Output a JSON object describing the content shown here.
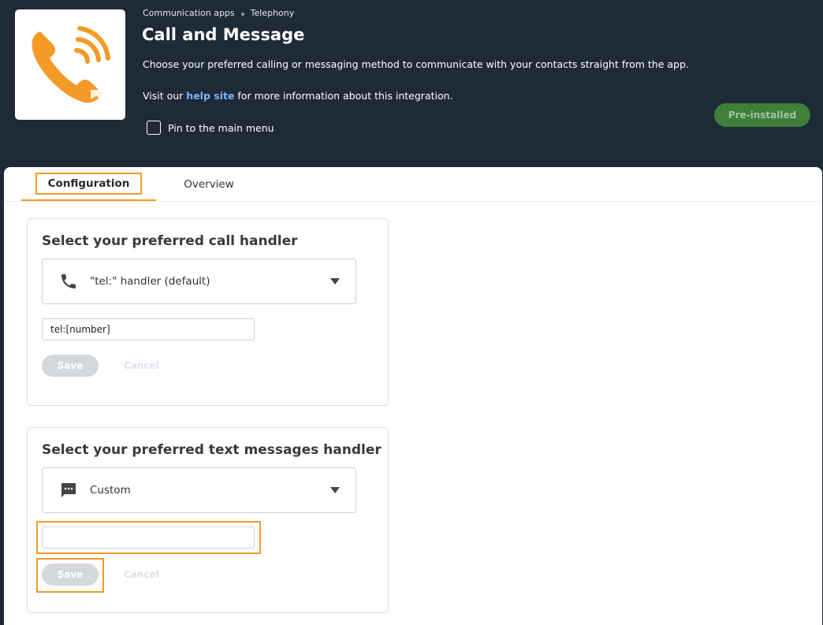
{
  "breadcrumb": {
    "parent": "Communication apps",
    "current": "Telephony"
  },
  "header": {
    "title": "Call and Message",
    "description": "Choose your preferred calling or messaging method to communicate with your contacts straight from the app.",
    "help_prefix": "Visit our ",
    "help_link": "help site",
    "help_suffix": " for more information about this integration.",
    "pin_label": "Pin to the main menu",
    "badge": "Pre-installed"
  },
  "tabs": [
    {
      "label": "Configuration",
      "active": true
    },
    {
      "label": "Overview",
      "active": false
    }
  ],
  "call_card": {
    "title": "Select your preferred call handler",
    "selected": "\"tel:\" handler (default)",
    "icon": "phone-icon",
    "input_value": "tel:[number]",
    "save_label": "Save",
    "cancel_label": "Cancel"
  },
  "sms_card": {
    "title": "Select your preferred text messages handler",
    "selected": "Custom",
    "icon": "message-icon",
    "input_value": "",
    "save_label": "Save",
    "cancel_label": "Cancel"
  },
  "colors": {
    "header_bg": "#1f2a37",
    "accent": "#f39a27",
    "badge_bg": "#3d7f3b",
    "link": "#7fb1ff"
  }
}
